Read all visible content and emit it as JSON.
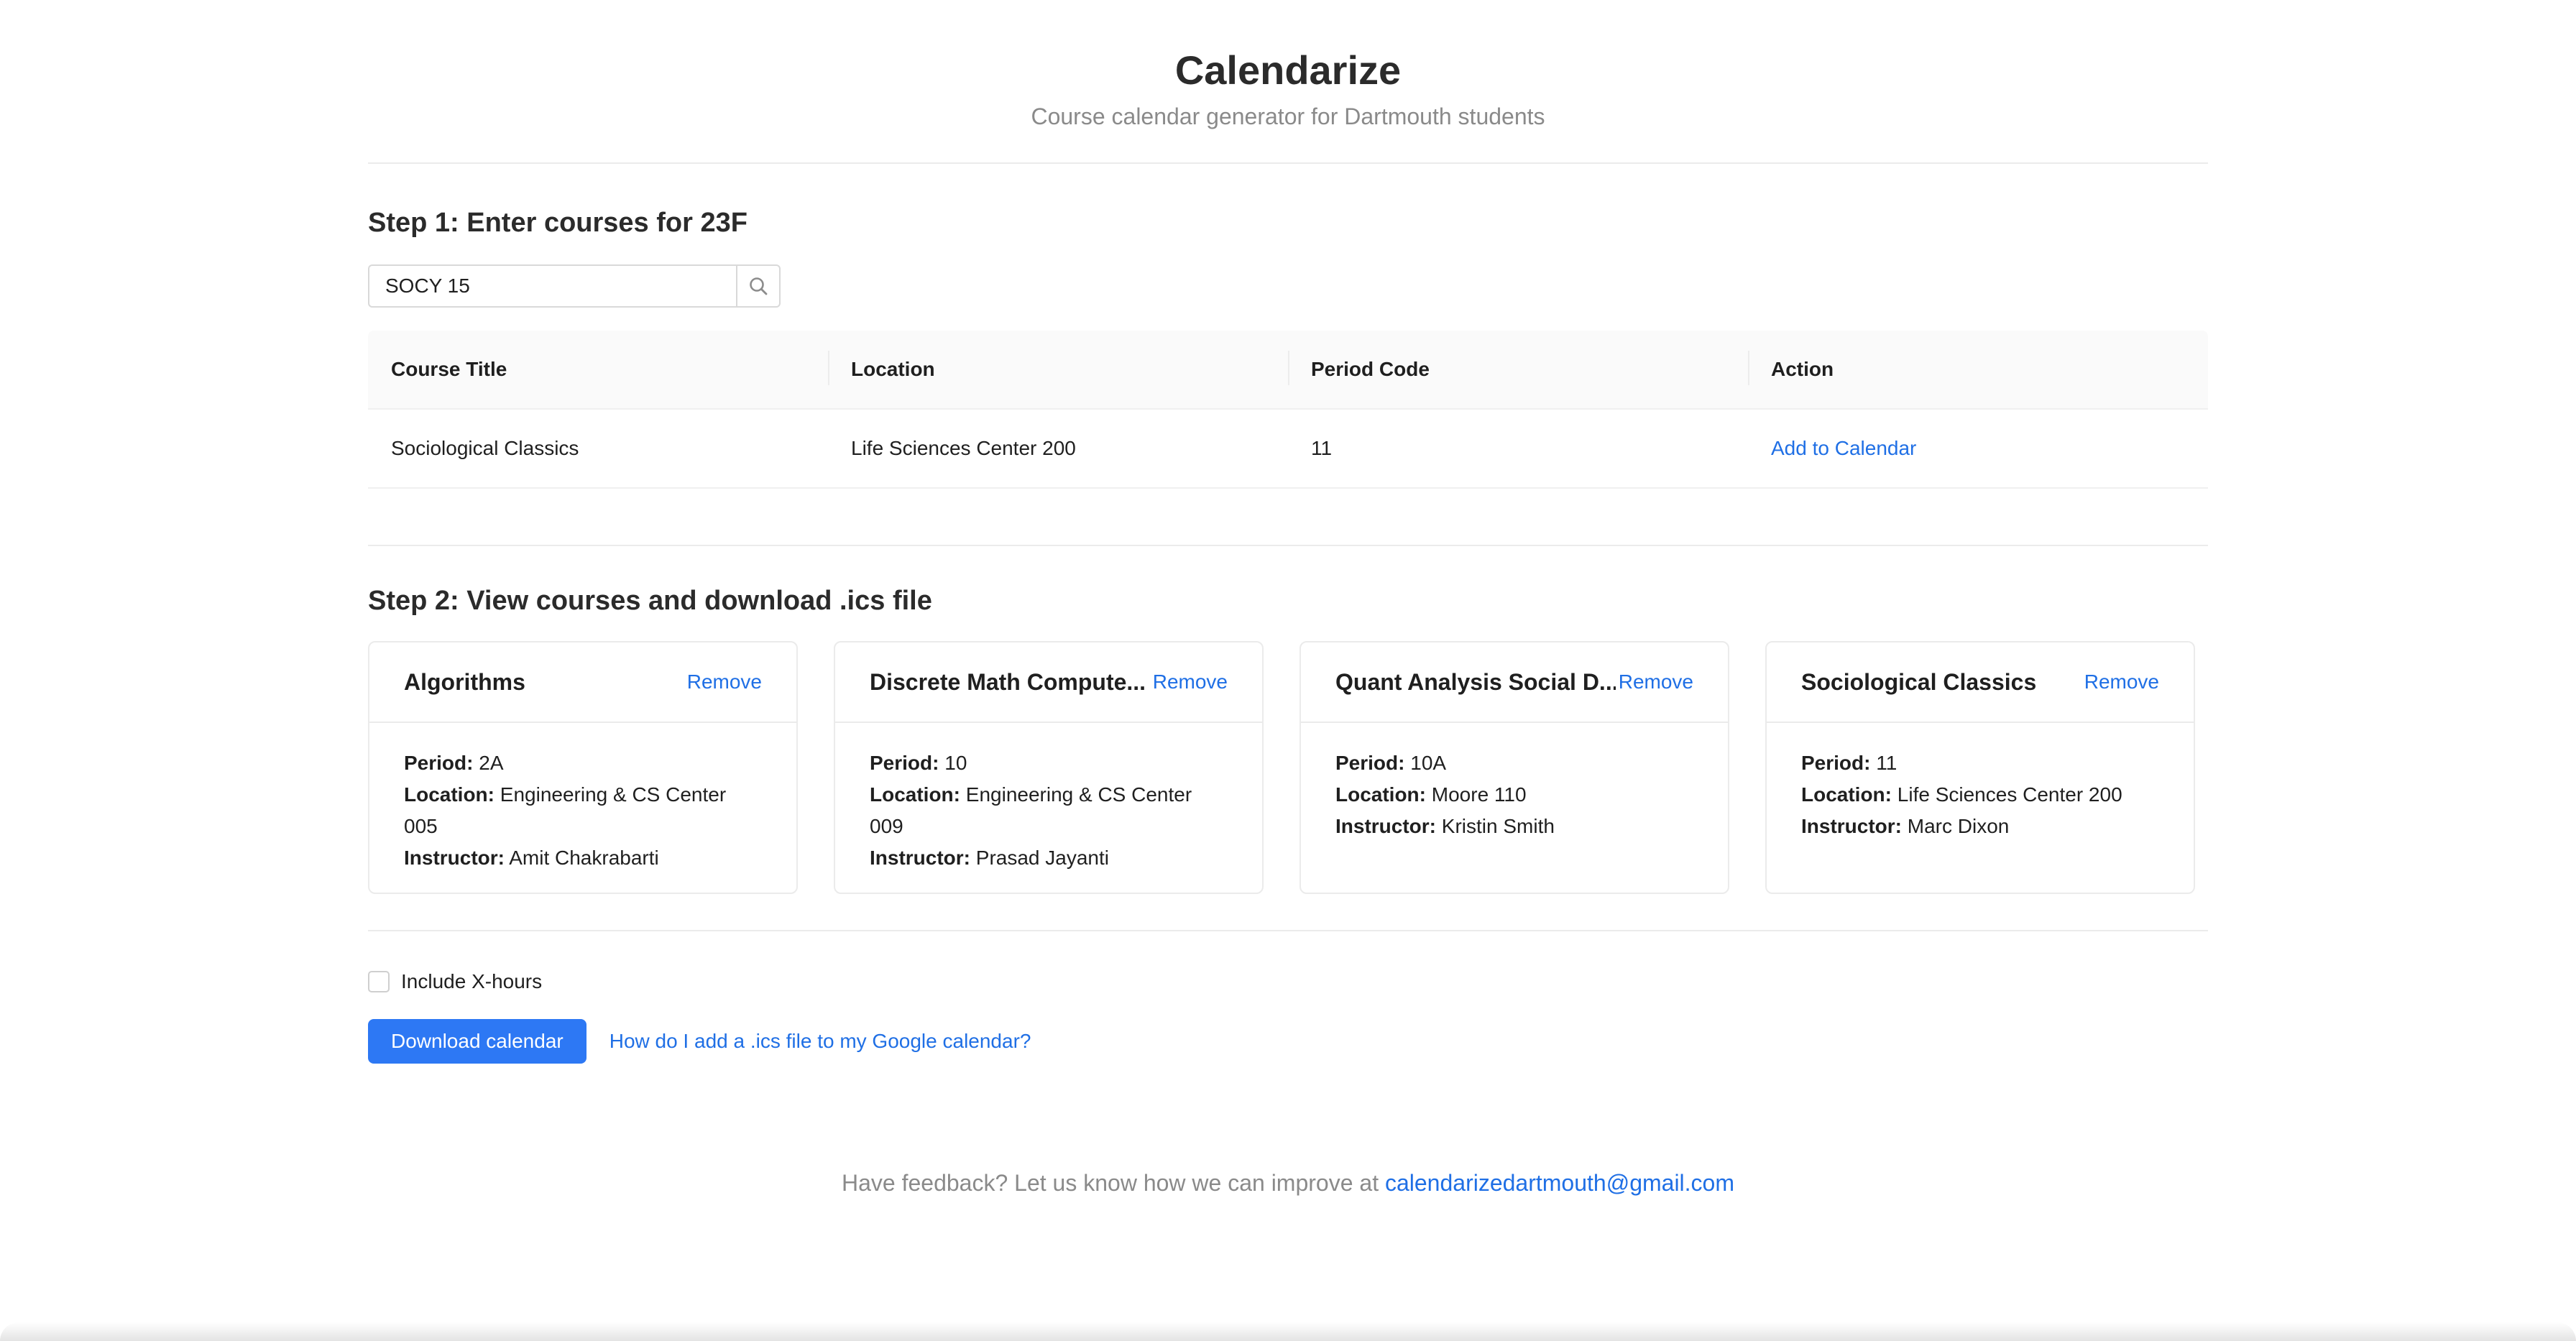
{
  "header": {
    "title": "Calendarize",
    "subtitle": "Course calendar generator for Dartmouth students"
  },
  "step1": {
    "title": "Step 1: Enter courses for 23F",
    "search": {
      "value": "SOCY 15",
      "icon": "search-icon"
    },
    "table": {
      "columns": [
        "Course Title",
        "Location",
        "Period Code",
        "Action"
      ],
      "rows": [
        {
          "course_title": "Sociological Classics",
          "location": "Life Sciences Center 200",
          "period_code": "11",
          "action": "Add to Calendar"
        }
      ]
    }
  },
  "step2": {
    "title": "Step 2: View courses and download .ics file",
    "period_label": "Period:",
    "location_label": "Location:",
    "instructor_label": "Instructor:",
    "cards": [
      {
        "title": "Algorithms",
        "remove": "Remove",
        "period": "2A",
        "location": "Engineering & CS Center 005",
        "instructor": "Amit Chakrabarti"
      },
      {
        "title": "Discrete Math Compute...",
        "remove": "Remove",
        "period": "10",
        "location": "Engineering & CS Center 009",
        "instructor": "Prasad Jayanti"
      },
      {
        "title": "Quant Analysis Social D...",
        "remove": "Remove",
        "period": "10A",
        "location": "Moore 110",
        "instructor": "Kristin Smith"
      },
      {
        "title": "Sociological Classics",
        "remove": "Remove",
        "period": "11",
        "location": "Life Sciences Center 200",
        "instructor": "Marc Dixon"
      }
    ]
  },
  "options": {
    "include_xhours_label": "Include X-hours",
    "include_xhours_checked": false
  },
  "actions": {
    "download_label": "Download calendar",
    "help_link": "How do I add a .ics file to my Google calendar?"
  },
  "footer": {
    "feedback_text": "Have feedback? Let us know how we can improve at",
    "email": "calendarizedartmouth@gmail.com"
  },
  "colors": {
    "accent": "#2d78f4",
    "link": "#1f6fe5",
    "muted_text": "#8a8a8a"
  }
}
